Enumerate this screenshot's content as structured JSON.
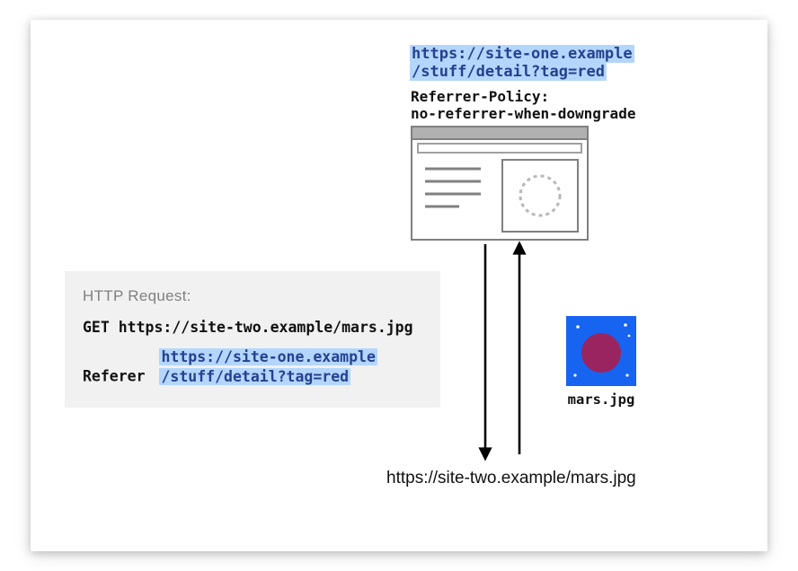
{
  "origin_url_line1": "https://site-one.example",
  "origin_url_line2": "/stuff/detail?tag=red",
  "policy_line1": "Referrer-Policy:",
  "policy_line2": "no-referrer-when-downgrade",
  "request_box": {
    "title": "HTTP Request:",
    "method_line": "GET https://site-two.example/mars.jpg",
    "referer_label": "Referer",
    "referer_url_line1": "https://site-one.example",
    "referer_url_line2": "/stuff/detail?tag=red"
  },
  "mars_label": "mars.jpg",
  "target_url": "https://site-two.example/mars.jpg",
  "colors": {
    "highlight_bg": "#b4d6fc",
    "highlight_fg": "#26418f",
    "mars_bg": "#1664f0",
    "mars_circle": "#9a2460",
    "browser_stroke": "#808080"
  }
}
